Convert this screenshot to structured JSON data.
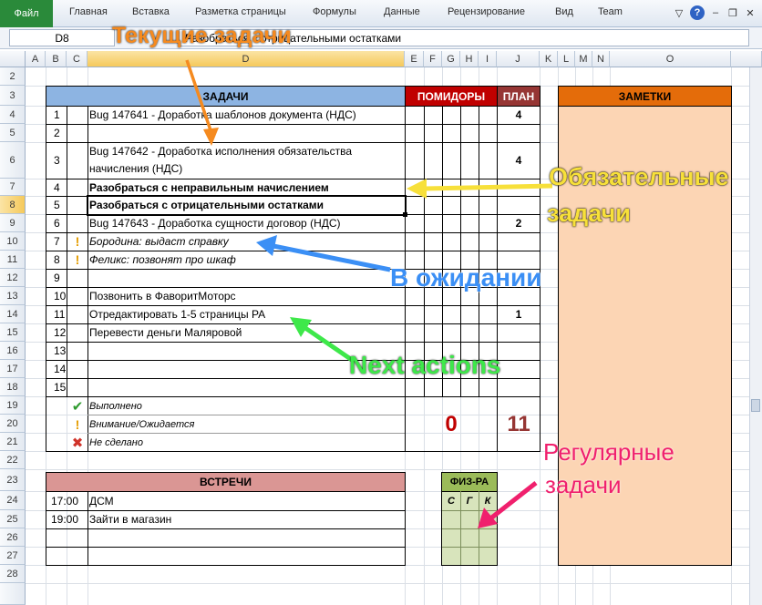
{
  "ribbon": {
    "file_tab": "Файл",
    "tabs": [
      "Главная",
      "Вставка",
      "Разметка страницы",
      "Формулы",
      "Данные",
      "Рецензирование",
      "Вид",
      "Team"
    ],
    "help_glyph": "?"
  },
  "formula_bar": {
    "name_box": "D8",
    "fx": "Разобраться с отрицательными остатками"
  },
  "columns": [
    "A",
    "B",
    "C",
    "D",
    "E",
    "F",
    "G",
    "H",
    "I",
    "J",
    "K",
    "L",
    "M",
    "N",
    "O"
  ],
  "selected_column": "D",
  "rows": [
    "2",
    "3",
    "4",
    "5",
    "6",
    "7",
    "8",
    "9",
    "10",
    "11",
    "12",
    "13",
    "14",
    "15",
    "16",
    "17",
    "18",
    "19",
    "20",
    "21",
    "22",
    "23",
    "24",
    "25",
    "26",
    "27",
    "28"
  ],
  "selected_row": "8",
  "tasks_section": {
    "header": "ЗАДАЧИ",
    "pomodoro_header": "ПОМИДОРЫ",
    "plan_header": "ПЛАН",
    "notes_header": "ЗАМЕТКИ",
    "items": [
      {
        "num": "1",
        "text": "Bug 147641 - Доработка шаблонов документа (НДС)",
        "plan": "4",
        "style": "normal",
        "mark": ""
      },
      {
        "num": "2",
        "text": "",
        "plan": "",
        "style": "normal",
        "mark": ""
      },
      {
        "num": "3",
        "text": "Bug 147642 - Доработка исполнения обязательства",
        "text2": "начисления (НДС)",
        "plan": "4",
        "style": "normal",
        "mark": ""
      },
      {
        "num": "4",
        "text": "Разобраться с неправильным начислением",
        "plan": "",
        "style": "bold",
        "mark": ""
      },
      {
        "num": "5",
        "text": "Разобраться с отрицательными остатками",
        "plan": "",
        "style": "bold",
        "mark": ""
      },
      {
        "num": "6",
        "text": "Bug 147643 - Доработка сущности договор (НДС)",
        "plan": "2",
        "style": "normal",
        "mark": ""
      },
      {
        "num": "7",
        "text": "Бородина: выдаст справку",
        "plan": "",
        "style": "italic",
        "mark": "!"
      },
      {
        "num": "8",
        "text": "Феликс: позвонят про шкаф",
        "plan": "",
        "style": "italic",
        "mark": "!"
      },
      {
        "num": "9",
        "text": "",
        "plan": "",
        "style": "normal",
        "mark": ""
      },
      {
        "num": "10",
        "text": "Позвонить в ФаворитМоторс",
        "plan": "",
        "style": "normal",
        "mark": ""
      },
      {
        "num": "11",
        "text": "Отредактировать 1-5 страницы РА",
        "plan": "1",
        "style": "normal",
        "mark": ""
      },
      {
        "num": "12",
        "text": "Перевести деньги Маляровой",
        "plan": "",
        "style": "normal",
        "mark": ""
      },
      {
        "num": "13",
        "text": "",
        "plan": "",
        "style": "normal",
        "mark": ""
      },
      {
        "num": "14",
        "text": "",
        "plan": "",
        "style": "normal",
        "mark": ""
      },
      {
        "num": "15",
        "text": "",
        "plan": "",
        "style": "normal",
        "mark": ""
      }
    ]
  },
  "legend": [
    {
      "icon": "✔",
      "text": "Выполнено"
    },
    {
      "icon": "!",
      "text": "Внимание/Ожидается"
    },
    {
      "icon": "✖",
      "text": "Не сделано"
    }
  ],
  "totals": {
    "pomodoro": "0",
    "plan": "11"
  },
  "meetings": {
    "header": "ВСТРЕЧИ",
    "items": [
      {
        "time": "17:00",
        "text": "ДСМ"
      },
      {
        "time": "19:00",
        "text": "Зайти в магазин"
      }
    ]
  },
  "fitness": {
    "header": "ФИЗ-РА",
    "days": [
      "С",
      "Г",
      "К"
    ]
  },
  "callouts": {
    "current": "Текущие задачи",
    "mandatory_1": "Обязательные",
    "mandatory_2": "задачи",
    "waiting": "В ожидании",
    "next": "Next actions",
    "regular_1": "Регулярные",
    "regular_2": "задачи"
  },
  "colors": {
    "tasks_header": "#8db4e2",
    "pomodoro_header": "#c00000",
    "plan_header": "#963634",
    "notes_header": "#e46c0a",
    "notes_fill": "#fcd5b4",
    "meetings_header": "#da9694",
    "fitness_fill": "#d8e4bc",
    "fitness_header": "#9bbb59",
    "callout_orange": "#f58a1f",
    "callout_yellow": "#f7e03a",
    "callout_blue": "#3b8ff5",
    "callout_green": "#3ee84a",
    "callout_pink": "#f0206d",
    "total_pomodoro": "#c00000",
    "total_plan": "#963634"
  }
}
